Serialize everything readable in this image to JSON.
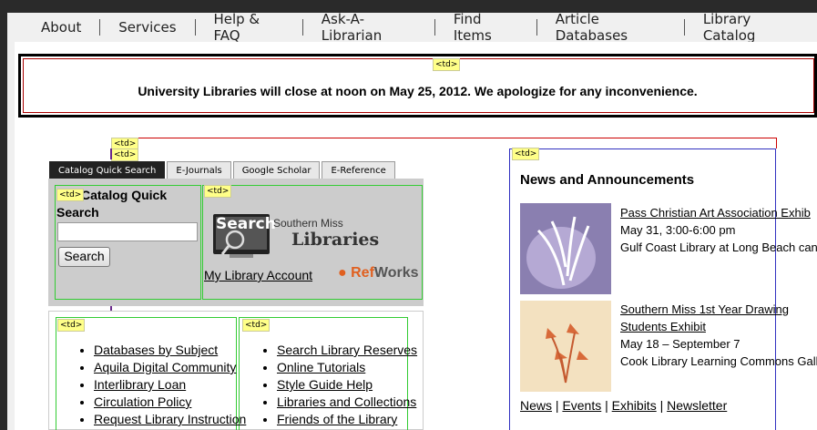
{
  "nav": [
    "About",
    "Services",
    "Help & FAQ",
    "Ask-A-Librarian",
    "Find Items",
    "Article Databases",
    "Library Catalog"
  ],
  "td_tag": "<td>",
  "notice": "University Libraries will close at noon on May 25, 2012. We apologize for any inconvenience.",
  "tabs": [
    "Catalog Quick Search",
    "E-Journals",
    "Google Scholar",
    "E-Reference"
  ],
  "quick_search": {
    "title": "Catalog Quick Search",
    "input_value": "",
    "button": "Search"
  },
  "logo": {
    "search_word": "Search",
    "line1": "Southern Miss",
    "line2": "Libraries"
  },
  "my_account": "My Library Account",
  "refworks": {
    "ref": "Ref",
    "works": "Works"
  },
  "links_left": [
    "Databases by Subject",
    "Aquila Digital Community",
    "Interlibrary Loan",
    "Circulation Policy",
    "Request Library Instruction"
  ],
  "links_right": [
    "Search Library Reserves",
    "Online Tutorials",
    "Style Guide Help",
    "Libraries and Collections",
    "Friends of the Library"
  ],
  "news": {
    "title": "News and Announcements",
    "items": [
      {
        "title": "Pass Christian Art Association Exhib",
        "date": "May 31, 3:00-6:00 pm",
        "place": "Gulf Coast Library at Long Beach can"
      },
      {
        "title1": "Southern Miss 1st Year Drawing",
        "title2": "Students Exhibit",
        "date": "May 18 – September 7",
        "place": "Cook Library Learning Commons Gall"
      }
    ],
    "footer": [
      "News",
      "Events",
      "Exhibits",
      "Newsletter"
    ],
    "footer_sep": "|"
  }
}
